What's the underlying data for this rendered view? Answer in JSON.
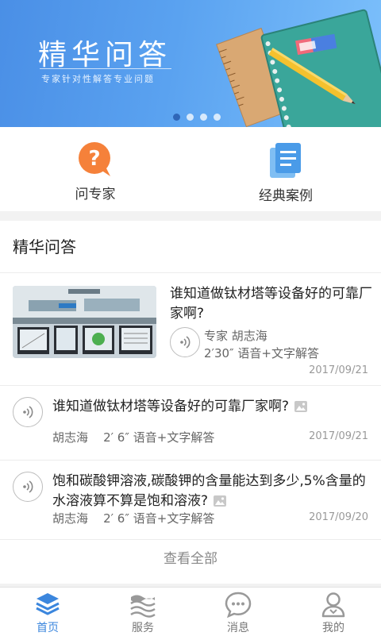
{
  "banner": {
    "title": "精华问答",
    "subtitle": "专家针对性解答专业问题",
    "dots": 4,
    "active_dot": 0
  },
  "quick_entries": [
    {
      "label": "问专家",
      "icon": "question-bubble-icon",
      "color": "#f5813a"
    },
    {
      "label": "经典案例",
      "icon": "document-list-icon",
      "color": "#4a9be8"
    }
  ],
  "section": {
    "title": "精华问答",
    "featured": {
      "question": "谁知道做钛材塔等设备好的可靠厂家啊?",
      "expert": "专家 胡志海",
      "meta": "2′30″ 语音+文字解答",
      "date": "2017/09/21"
    },
    "items": [
      {
        "question": "谁知道做钛材塔等设备好的可靠厂家啊?",
        "author": "胡志海",
        "duration": "2′ 6″",
        "answer_type": "语音+文字解答",
        "date": "2017/09/21"
      },
      {
        "question": "饱和碳酸钾溶液,碳酸钾的含量能达到多少,5%含量的水溶液算不算是饱和溶液?",
        "author": "胡志海",
        "duration": "2′ 6″",
        "answer_type": "语音+文字解答",
        "date": "2017/09/20"
      }
    ],
    "view_all": "查看全部"
  },
  "tabbar": {
    "active_color": "#3b86dd",
    "tabs": [
      {
        "label": "首页",
        "icon": "layers-icon",
        "active": true
      },
      {
        "label": "服务",
        "icon": "waves-icon",
        "active": false
      },
      {
        "label": "消息",
        "icon": "chat-bubble-icon",
        "active": false
      },
      {
        "label": "我的",
        "icon": "user-icon",
        "active": false
      }
    ]
  }
}
